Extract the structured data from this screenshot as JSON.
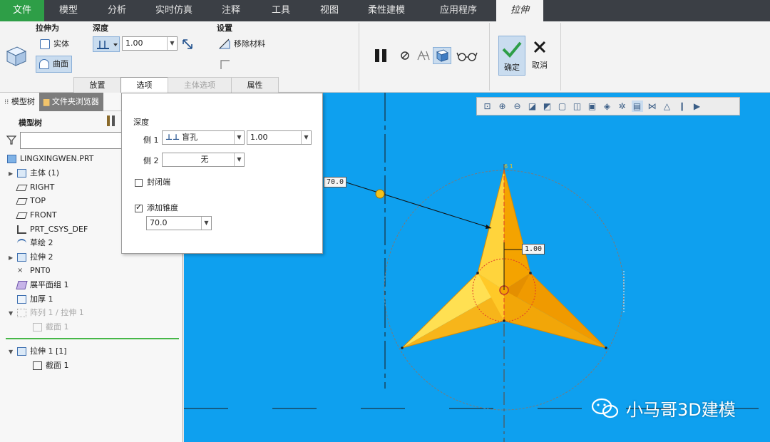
{
  "ribbon_tabs": [
    "文件",
    "模型",
    "分析",
    "实时仿真",
    "注释",
    "工具",
    "视图",
    "柔性建模",
    "应用程序",
    "拉伸"
  ],
  "active_tab": "拉伸",
  "extrude_as": {
    "label": "拉伸为",
    "solid": "实体",
    "surface": "曲面"
  },
  "depth": {
    "label": "深度",
    "value": "1.00"
  },
  "settings": {
    "label": "设置",
    "remove_material": "移除材料"
  },
  "confirm": {
    "ok": "确定",
    "cancel": "取消"
  },
  "sub_tabs": [
    "放置",
    "选项",
    "主体选项",
    "属性"
  ],
  "left_tabs": {
    "model_tree": "模型树",
    "folder_browser": "文件夹浏览器"
  },
  "tree_header": "模型树",
  "tree": [
    {
      "label": "LINGXINGWEN.PRT",
      "expand": ""
    },
    {
      "label": "主体 (1)",
      "expand": "▶"
    },
    {
      "label": "RIGHT",
      "expand": ""
    },
    {
      "label": "TOP",
      "expand": ""
    },
    {
      "label": "FRONT",
      "expand": ""
    },
    {
      "label": "PRT_CSYS_DEF",
      "expand": ""
    },
    {
      "label": "草绘 2",
      "expand": ""
    },
    {
      "label": "拉伸 2",
      "expand": "▶"
    },
    {
      "label": "PNT0",
      "expand": ""
    },
    {
      "label": "展平面组 1",
      "expand": ""
    },
    {
      "label": "加厚 1",
      "expand": ""
    },
    {
      "label": "阵列 1 / 拉伸 1",
      "expand": "▼"
    },
    {
      "label": "截面 1",
      "expand": ""
    }
  ],
  "insert_tree": [
    {
      "label": "拉伸 1 [1]",
      "expand": "▼"
    },
    {
      "label": "截面 1",
      "expand": ""
    }
  ],
  "options_panel": {
    "depth_label": "深度",
    "side1_label": "侧 1",
    "side1_type": "盲孔",
    "side1_value": "1.00",
    "side2_label": "侧 2",
    "side2_type": "无",
    "capped_ends": "封闭端",
    "add_taper": "添加锥度",
    "taper_value": "70.0"
  },
  "viewport": {
    "dim_angle": "70.0",
    "dim_depth": "1.00",
    "top_label": "6  1",
    "watermark": "小马哥3D建模"
  },
  "colors": {
    "file_tab": "#2e9e47",
    "viewport_bg": "#0ea0ef",
    "part_light": "#ffd23a",
    "part_dark": "#f0a000"
  }
}
